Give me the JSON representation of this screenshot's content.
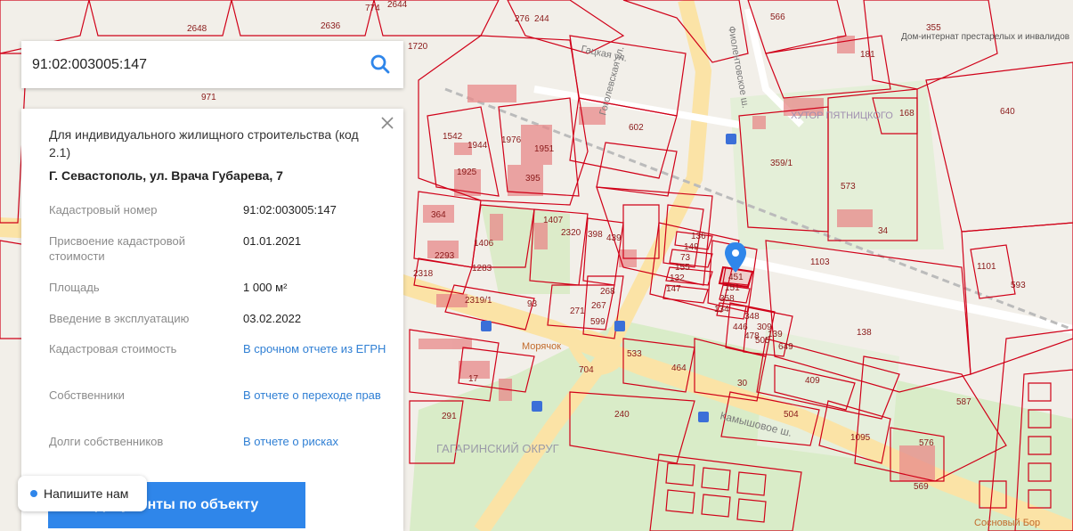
{
  "search": {
    "value": "91:02:003005:147"
  },
  "object": {
    "purpose": "Для индивидуального жилищного строительства (код 2.1)",
    "address": "Г. Севастополь, ул. Врача Губарева, 7",
    "rows": [
      {
        "label": "Кадастровый номер",
        "value": "91:02:003005:147"
      },
      {
        "label": "Присвоение кадастровой стоимости",
        "value": "01.01.2021"
      },
      {
        "label": "Площадь",
        "value": "1 000 м²"
      },
      {
        "label": "Введение в эксплуатацию",
        "value": "03.02.2022"
      },
      {
        "label": "Кадастровая стоимость",
        "link": "В срочном отчете из ЕГРН"
      },
      {
        "label": "Собственники",
        "link": "В отчете о переходе прав"
      },
      {
        "label": "Долги собственников",
        "link": "В отчете о рисках"
      }
    ]
  },
  "docs_button": "Документы по объекту",
  "chat": "Напишите нам",
  "map": {
    "places": [
      "Фиолентовское ш.",
      "Гоголевская ул.",
      "Гацкая ул.",
      "Камышовое ш.",
      "ХУТОР ПЯТНИЦКОГО",
      "ГАГАРИНСКИЙ ОКРУГ",
      "Дом-интернат престарелых и инвалидов",
      "Морячок",
      "Сосновый Бор"
    ],
    "parcels": [
      "2636",
      "2648",
      "774",
      "2644",
      "276",
      "244",
      "566",
      "355",
      "181",
      "1720",
      "971",
      "1542",
      "1944",
      "1976",
      "1951",
      "1925",
      "395",
      "602",
      "359/1",
      "573",
      "168",
      "640",
      "364",
      "1406",
      "1407",
      "2320",
      "398",
      "439",
      "2293",
      "1283",
      "2318",
      "2319/1",
      "93",
      "271",
      "268",
      "267",
      "599",
      "1103",
      "1101",
      "593",
      "138",
      "136",
      "149",
      "73",
      "155",
      "132",
      "147",
      "451",
      "151",
      "358",
      "134",
      "446",
      "348",
      "478",
      "309",
      "505",
      "139",
      "649",
      "704",
      "464",
      "533",
      "409",
      "240",
      "504",
      "1095",
      "587",
      "576",
      "569",
      "291",
      "17",
      "34",
      "30"
    ]
  }
}
